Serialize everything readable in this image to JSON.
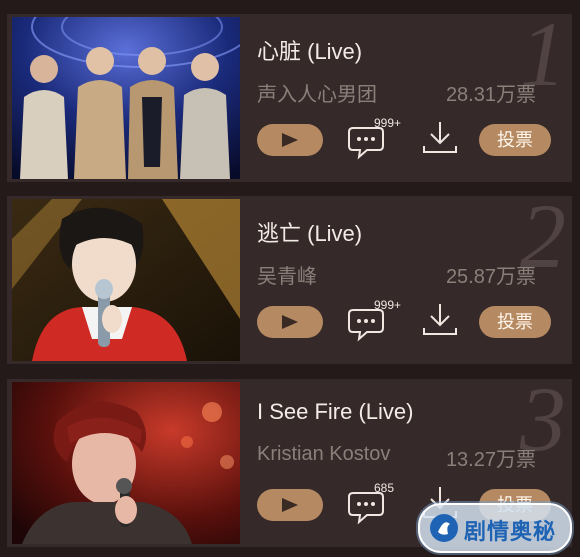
{
  "songs": [
    {
      "rank": "1",
      "title": "心脏 (Live)",
      "artist": "声入人心男团",
      "votes": "28.31万票",
      "comments": "999+",
      "vote_label": "投票"
    },
    {
      "rank": "2",
      "title": "逃亡 (Live)",
      "artist": "吴青峰",
      "votes": "25.87万票",
      "comments": "999+",
      "vote_label": "投票"
    },
    {
      "rank": "3",
      "title": "I See Fire (Live)",
      "artist": "Kristian Kostov",
      "votes": "13.27万票",
      "comments": "685",
      "vote_label": "投票"
    }
  ],
  "icons": {
    "play": "play-icon",
    "comment": "comment-bubble-icon",
    "download": "download-icon"
  },
  "colors": {
    "background": "#241a19",
    "card": "#36292a",
    "accent": "#b58a62",
    "secondary_text": "#8b7f79"
  },
  "watermark": {
    "text": "剧情奥秘"
  }
}
